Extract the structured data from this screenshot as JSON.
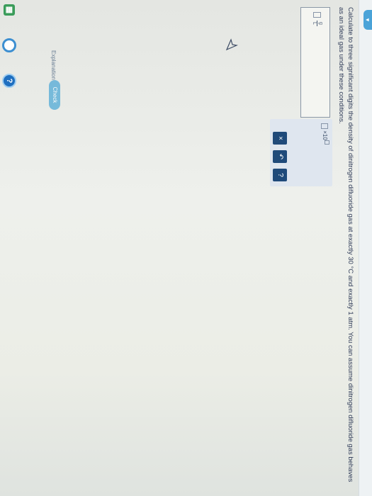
{
  "question": {
    "text": "Calculate to three significant digits the density of dinitrogen difluoride gas at exactly 30 °C and exactly 1 atm. You can assume dinitrogen difluoride gas behaves as an ideal gas under these conditions."
  },
  "answer": {
    "unit_numerator": "g",
    "unit_denominator": "L"
  },
  "keypad": {
    "sci_notation_label": "×10",
    "clear_label": "×",
    "undo_label": "↶",
    "help_label": "?"
  },
  "actions": {
    "explanation_label": "Explanation",
    "check_label": "Check"
  },
  "sidebar": {
    "grid_icon_label": "▦",
    "help_icon_label": "?"
  },
  "colors": {
    "accent": "#4aa3d8",
    "keypad_button": "#1f4a7a",
    "check_button": "#5aaed8"
  }
}
